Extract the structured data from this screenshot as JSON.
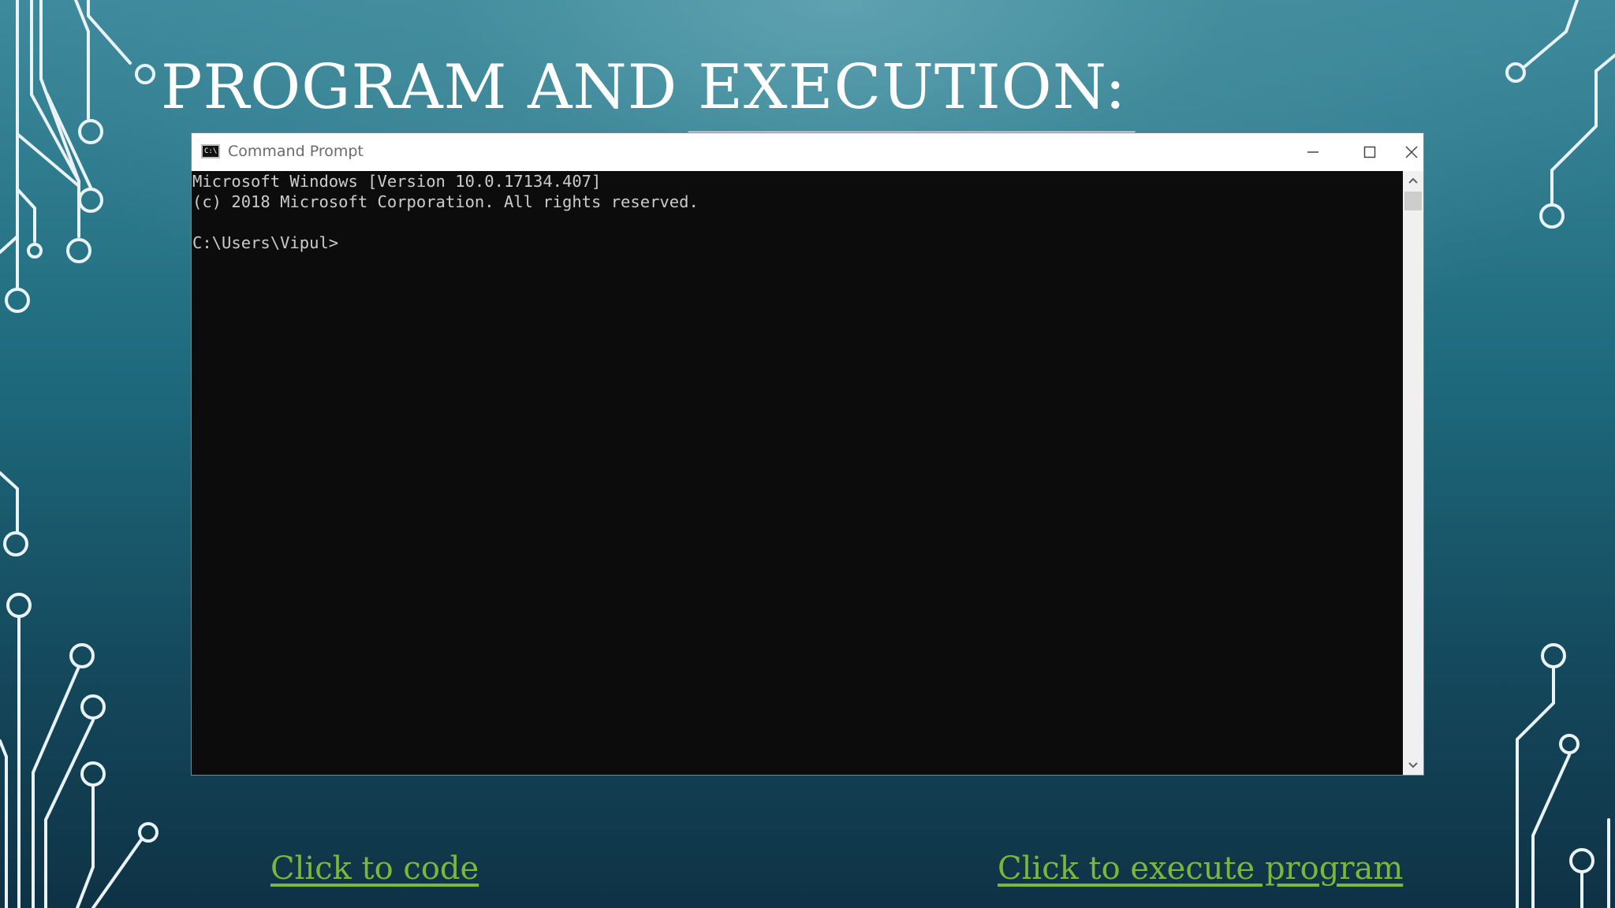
{
  "slide": {
    "title": "PROGRAM AND EXECUTION:"
  },
  "window": {
    "title": "Command Prompt",
    "icon_text": "C:\\.",
    "controls": [
      "minimize-icon",
      "maximize-icon",
      "close-icon"
    ]
  },
  "console": {
    "lines": [
      "Microsoft Windows [Version 10.0.17134.407]",
      "(c) 2018 Microsoft Corporation. All rights reserved.",
      "",
      "C:\\Users\\Vipul>"
    ]
  },
  "links": {
    "code": "Click to code",
    "execute": "Click to execute program"
  },
  "colors": {
    "link": "#7ab839",
    "console_bg": "#0c0c0c",
    "console_text": "#cccccc",
    "title_text": "#ffffff"
  }
}
